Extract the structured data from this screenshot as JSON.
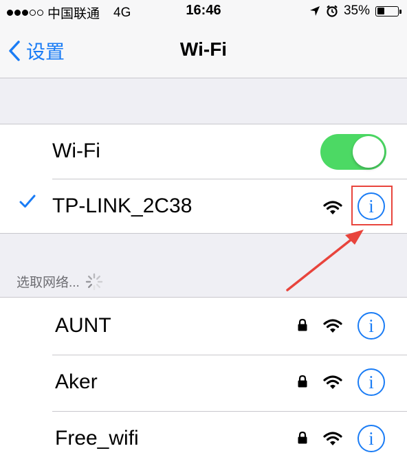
{
  "status_bar": {
    "carrier": "中国联通",
    "network": "4G",
    "time": "16:46",
    "battery": "35%",
    "battery_level": 0.35
  },
  "nav": {
    "back_label": "设置",
    "title": "Wi-Fi"
  },
  "wifi_toggle": {
    "label": "Wi-Fi",
    "on": true
  },
  "connected_network": {
    "name": "TP-LINK_2C38"
  },
  "choose_network": {
    "header": "选取网络..."
  },
  "networks": [
    {
      "name": "AUNT",
      "locked": true
    },
    {
      "name": "Aker",
      "locked": true
    },
    {
      "name": "Free_wifi",
      "locked": true
    }
  ],
  "colors": {
    "accent": "#1a7cf5",
    "toggle_on": "#4cd964",
    "annotation_red": "#e8443c"
  }
}
